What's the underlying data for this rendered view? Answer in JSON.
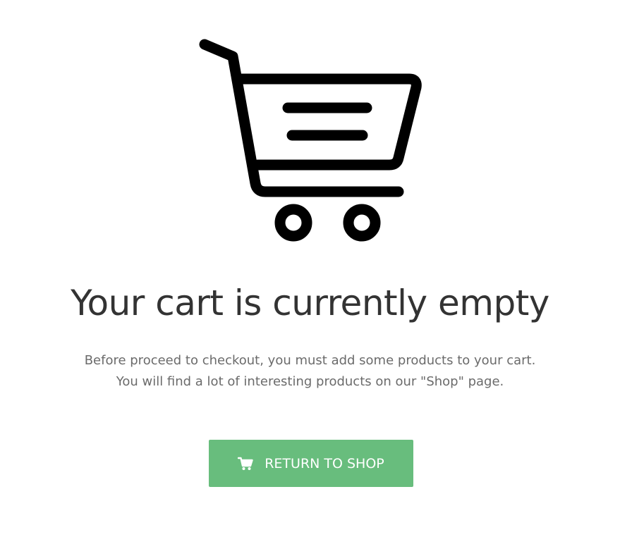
{
  "empty_cart": {
    "illustration_icon": "shopping-cart-icon",
    "heading": "Your cart is currently empty",
    "description_line1": "Before proceed to checkout, you must add some products to your cart.",
    "description_line2": "You will find a lot of interesting products on our \"Shop\" page.",
    "button": {
      "icon": "cart-icon",
      "label": "RETURN TO SHOP",
      "color": "#68bd7d"
    }
  }
}
